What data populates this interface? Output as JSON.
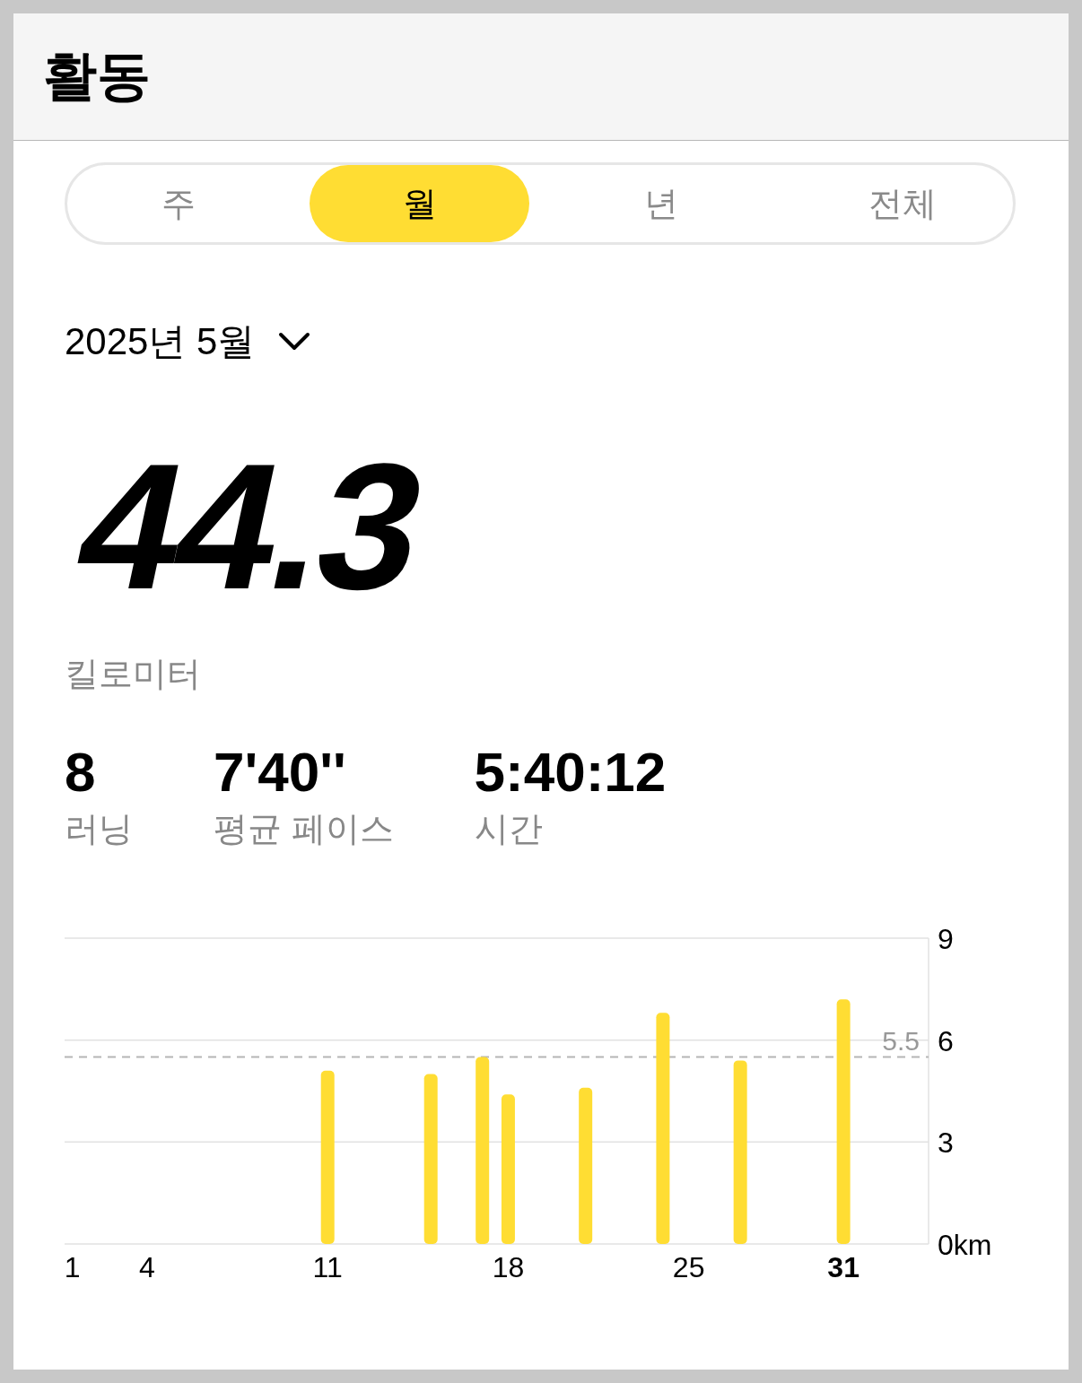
{
  "header": {
    "title": "활동"
  },
  "tabs": [
    {
      "label": "주",
      "selected": false
    },
    {
      "label": "월",
      "selected": true
    },
    {
      "label": "년",
      "selected": false
    },
    {
      "label": "전체",
      "selected": false
    }
  ],
  "period": {
    "label": "2025년 5월"
  },
  "total": {
    "value": "44.3",
    "unit": "킬로미터"
  },
  "stats": [
    {
      "value": "8",
      "label": "러닝"
    },
    {
      "value": "7'40''",
      "label": "평균 페이스"
    },
    {
      "value": "5:40:12",
      "label": "시간"
    }
  ],
  "chart_data": {
    "type": "bar",
    "x": [
      11,
      15,
      17,
      18,
      21,
      24,
      27,
      31
    ],
    "series": [
      {
        "color": "#ffdd33",
        "values": [
          5.1,
          5.0,
          5.5,
          4.4,
          4.6,
          6.8,
          5.4,
          7.2
        ]
      }
    ],
    "xlim": [
      0.8,
      34.3
    ],
    "ylim": [
      0,
      9
    ],
    "xticks": [
      1,
      4,
      11,
      18,
      25,
      31
    ],
    "yticks": [
      {
        "value": 0,
        "label": "0km"
      },
      3,
      6,
      9
    ],
    "ref_lines": [
      {
        "axis": "y",
        "value": 5.5,
        "label": "5.5"
      }
    ]
  }
}
